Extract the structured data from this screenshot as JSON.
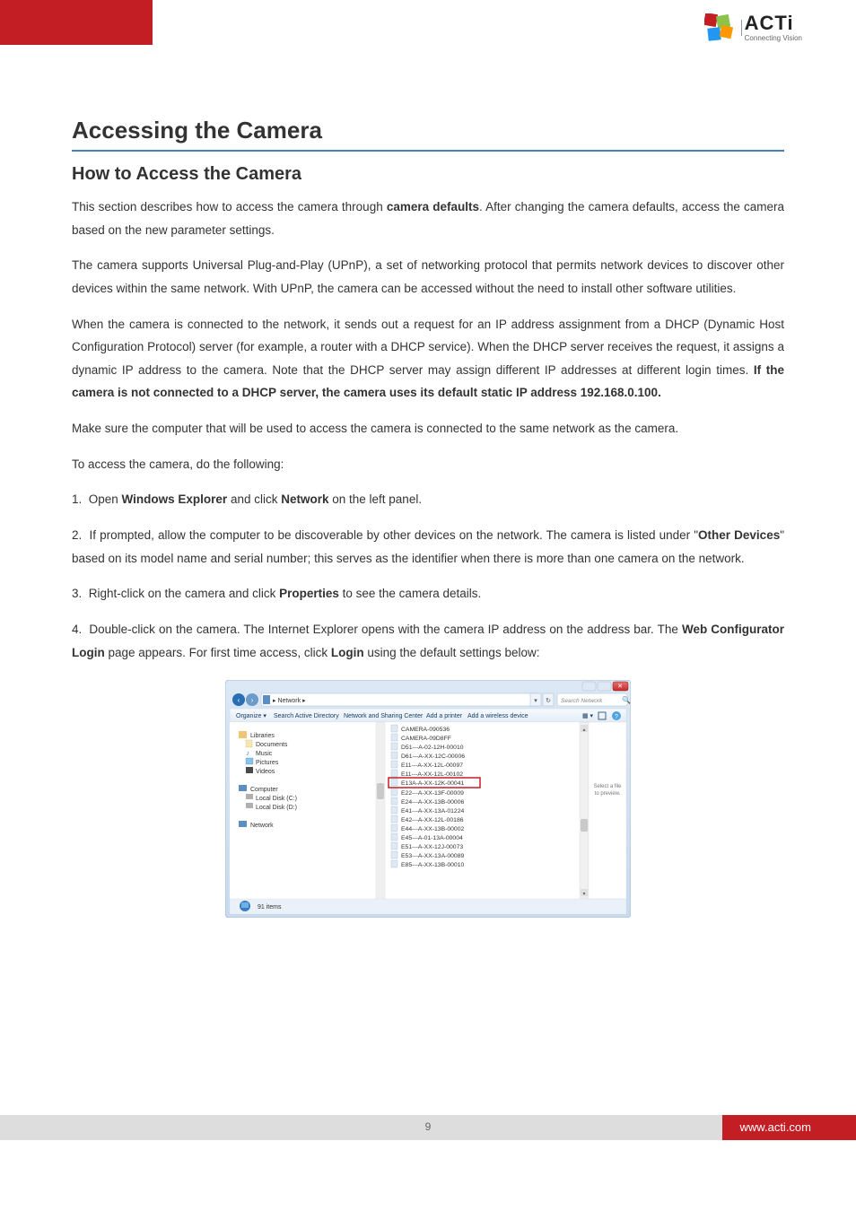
{
  "header": {
    "brand": "ACTi",
    "tagline": "Connecting Vision"
  },
  "h1": "Accessing the Camera",
  "h2": "How to Access the Camera",
  "p1_a": "This section describes how to access the camera through ",
  "p1_b": "camera defaults",
  "p1_c": ". After changing the camera defaults, access the camera based on the new parameter settings.",
  "p2": "The camera supports Universal Plug-and-Play (UPnP), a set of networking protocol that permits network devices to discover other devices within the same network. With UPnP, the camera can be accessed without the need to install other software utilities.",
  "p3_a": "When the camera is connected to the network, it sends out a request for an IP address assignment from a DHCP (Dynamic Host Configuration Protocol) server (for example, a router with a DHCP service). When the DHCP server receives the request, it assigns a dynamic IP address to the camera. Note that the DHCP server may assign different IP addresses at different login times. ",
  "p3_b": "If the camera is not connected to a DHCP server, the camera uses its default static IP address 192.168.0.100.",
  "p4": "Make sure the computer that will be used to access the camera is connected to the same network as the camera.",
  "steps_title": "To access the camera, do the following:",
  "step1_a": "Open ",
  "step1_b": "Windows Explorer",
  "step1_c": " and click ",
  "step1_d": "Network",
  "step1_e": " on the left panel.",
  "step2_a": "If prompted, allow the computer to be discoverable by other devices on the network. The camera is listed under \"",
  "step2_b": "Other Devices",
  "step2_c": "\" based on its model name and serial number; this serves as the identifier when there is more than one camera on the network.",
  "step3_a": "Right-click on the camera and click ",
  "step3_b": "Properties",
  "step3_c": " to see the camera details.",
  "step4_a": "Double-click on the camera. The Internet Explorer opens with the camera IP address on the address bar. The ",
  "step4_b": "Web Configurator Login",
  "step4_c": " page appears. For first time access, click ",
  "step4_d": "Login",
  "step4_e": " using the default settings below:",
  "screenshot": {
    "breadcrumb": "Network",
    "toolbar": {
      "organize": "Organize",
      "search_ad": "Search Active Directory",
      "nsc": "Network and Sharing Center",
      "add_printer": "Add a printer",
      "add_wireless": "Add a wireless device"
    },
    "search_placeholder": "Search Network",
    "nav": {
      "libraries": "Libraries",
      "documents": "Documents",
      "music": "Music",
      "pictures": "Pictures",
      "videos": "Videos",
      "computer": "Computer",
      "local_c": "Local Disk (C:)",
      "local_d": "Local Disk (D:)",
      "network": "Network"
    },
    "devices": [
      "CAMERA-090536",
      "CAMERA-09D8FF",
      "D51---A-02-12H-00010",
      "D61---A-XX-12C-00006",
      "E11---A-XX-12L-00097",
      "E11---A-XX-12L-00102",
      "E13A-A-XX-12K-00041",
      "E22---A-XX-13F-00009",
      "E24---A-XX-13B-00006",
      "E41---A-XX-13A-01224",
      "E42---A-XX-12L-00186",
      "E44---A-XX-13B-00002",
      "E45---A-01-13A-00004",
      "E51---A-XX-12J-00073",
      "E53---A-XX-13A-00089",
      "E85---A-XX-13B-00010"
    ],
    "highlighted_device": "E13A-A-XX-12K-00041",
    "preview_text": "Select a file to preview.",
    "status": "91 items"
  },
  "footer": {
    "url": "www.acti.com",
    "page": "9"
  }
}
